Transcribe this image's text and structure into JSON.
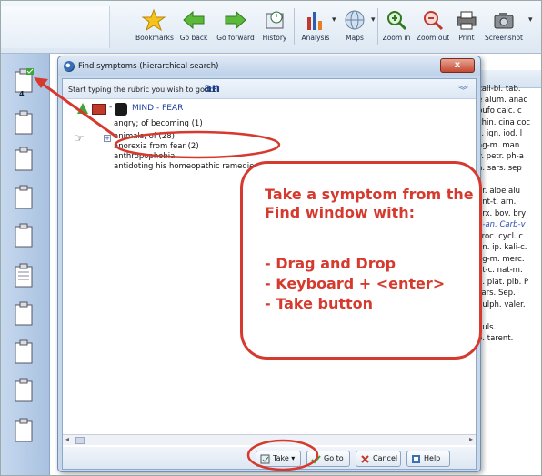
{
  "toolbar": {
    "buttons": [
      {
        "name": "bookmarks",
        "label": "Bookmarks"
      },
      {
        "name": "go-back",
        "label": "Go back"
      },
      {
        "name": "go-forward",
        "label": "Go forward"
      },
      {
        "name": "history",
        "label": "History"
      },
      {
        "name": "analysis",
        "label": "Analysis"
      },
      {
        "name": "maps",
        "label": "Maps"
      },
      {
        "name": "zoom-in",
        "label": "Zoom in"
      },
      {
        "name": "zoom-out",
        "label": "Zoom out"
      },
      {
        "name": "print",
        "label": "Print"
      },
      {
        "name": "screenshot",
        "label": "Screenshot"
      }
    ]
  },
  "leftpanel": {
    "clip_number": "4"
  },
  "dialog": {
    "title": "Find symptoms (hierarchical search)",
    "close_label": "x",
    "prompt_label": "Start typing the rubric you wish to go to:",
    "prompt_value": "an",
    "path": "MIND - FEAR",
    "items": [
      "angry; of becoming (1)",
      "animals, of (28)",
      "anorexia from fear (2)",
      "anthropophobia",
      "antidoting his homeopathic remedies"
    ],
    "buttons": {
      "take": "Take",
      "goto": "Go to",
      "cancel": "Cancel",
      "help": "Help"
    }
  },
  "background_doc": {
    "lines": [
      {
        "text": "kali-bi. tab.",
        "blue": false
      },
      {
        "text": "e alum. anac",
        "blue": false
      },
      {
        "text": "bufo calc. c",
        "blue": false
      },
      {
        "text": "chin. cina coc",
        "blue": false
      },
      {
        "text": "s. ign. iod. l",
        "blue": false
      },
      {
        "text": "ag-m. man",
        "blue": false
      },
      {
        "text": "v. petr. ph-a",
        "blue": false
      },
      {
        "text": "n. sars. sep",
        "blue": false
      },
      {
        "text": "ar. aloe alu",
        "blue": false
      },
      {
        "text": "ant-t. arn.",
        "blue": false
      },
      {
        "text": "orx. bov. bry",
        "blue": false
      },
      {
        "text": "b-an. Carb-v",
        "blue": true
      },
      {
        "text": "croc. cycl. c",
        "blue": false
      },
      {
        "text": "gn. ip. kali-c.",
        "blue": false
      },
      {
        "text": "ag-m. merc.",
        "blue": false
      },
      {
        "text": "at-c. nat-m.",
        "blue": false
      },
      {
        "text": "n. plat. plb. P",
        "blue": false
      },
      {
        "text": "sars. Sep.",
        "blue": false
      },
      {
        "text": "Sulph. valer.",
        "blue": false
      },
      {
        "text": "puls.",
        "blue": false
      },
      {
        "text": "b. tarent.",
        "blue": false
      }
    ]
  },
  "callout": {
    "title": "Take a symptom from the Find window with:",
    "lines": [
      "- Drag and Drop",
      "- Keyboard  + <enter>",
      "- Take button"
    ]
  },
  "colors": {
    "accent_red": "#d63a2e",
    "link_blue": "#1a3da0"
  }
}
